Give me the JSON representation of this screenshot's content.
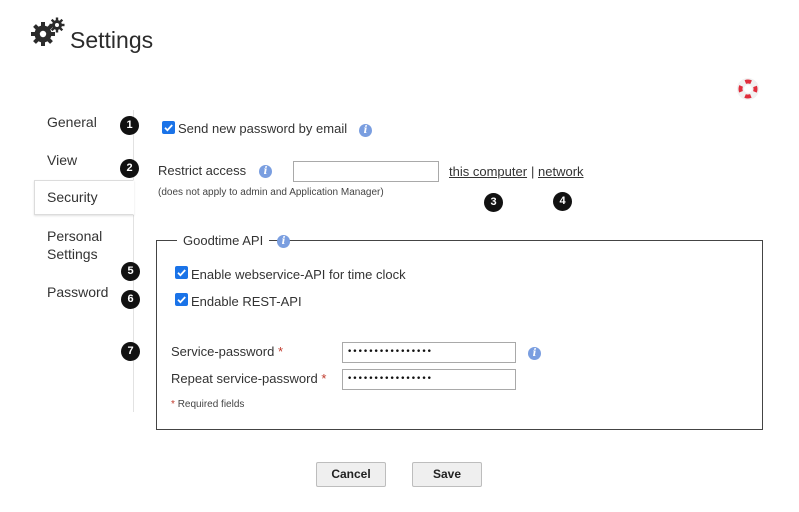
{
  "header": {
    "title": "Settings",
    "icon": "gears-icon"
  },
  "sidebar": {
    "items": [
      {
        "label": "General"
      },
      {
        "label": "View"
      },
      {
        "label": "Security",
        "active": true
      },
      {
        "label": "Personal Settings"
      },
      {
        "label": "Password"
      }
    ]
  },
  "badges": [
    "1",
    "2",
    "3",
    "4",
    "5",
    "6",
    "7"
  ],
  "security": {
    "send_password_label": "Send new password by email",
    "send_password_checked": true,
    "restrict_label": "Restrict access",
    "restrict_value": "",
    "restrict_note": "(does not apply to admin and Application Manager)",
    "link_this_computer": "this computer",
    "link_separator": "|",
    "link_network": "network"
  },
  "api": {
    "legend": "Goodtime API",
    "enable_webservice_label": "Enable webservice-API for time clock",
    "enable_webservice_checked": true,
    "enable_rest_label": "Endable REST-API",
    "enable_rest_checked": true,
    "service_password_label": "Service-password",
    "service_password_value": "••••••••••••••••",
    "repeat_password_label": "Repeat service-password",
    "repeat_password_value": "••••••••••••••••",
    "required_marker": "*",
    "required_note": "Required fields"
  },
  "buttons": {
    "cancel": "Cancel",
    "save": "Save"
  },
  "colors": {
    "accent": "#1a73e8",
    "info": "#7a9ee0",
    "required": "#c0392b",
    "help_widget": "#e02d3c"
  }
}
